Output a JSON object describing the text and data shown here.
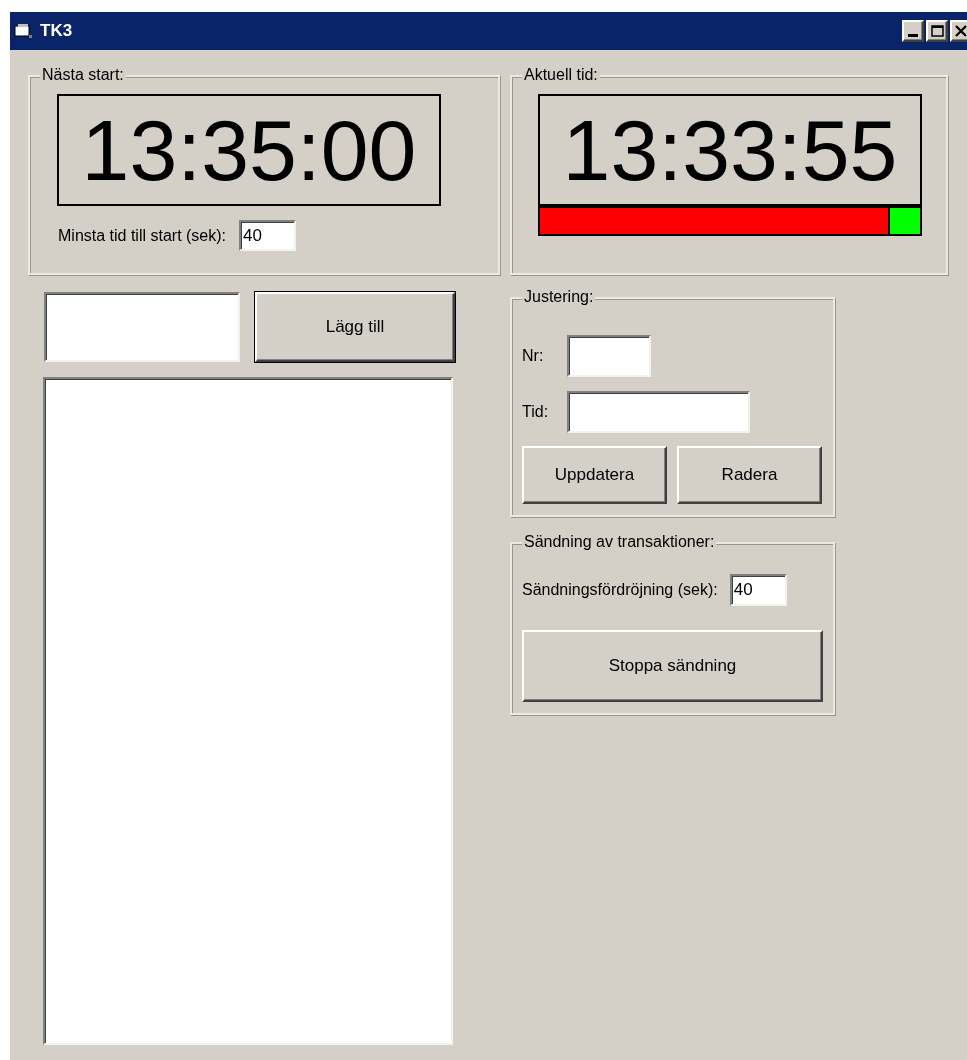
{
  "window": {
    "title": "TK3"
  },
  "next_start": {
    "title": "Nästa start:",
    "time": "13:35:00",
    "min_label": "Minsta tid till start (sek):",
    "min_value": "40"
  },
  "add": {
    "button": "Lägg till"
  },
  "current": {
    "title": "Aktuell tid:",
    "time": "13:33:55",
    "progress": {
      "level": 0.92
    }
  },
  "adjust": {
    "title": "Justering:",
    "nr_label": "Nr:",
    "tid_label": "Tid:",
    "buttons": [
      "Uppdatera",
      "Radera"
    ]
  },
  "send": {
    "title": "Sändning av transaktioner:",
    "delay_label": "Sändningsfördröjning (sek):",
    "delay_value": "40",
    "button": "Stoppa sändning"
  }
}
